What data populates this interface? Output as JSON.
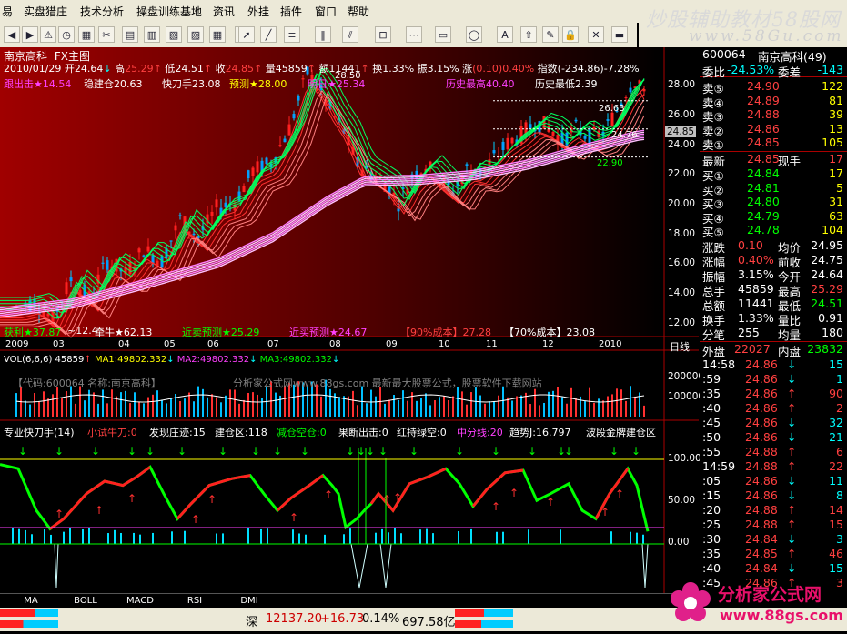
{
  "menu": [
    "易",
    "实盘猎庄",
    "技术分析",
    "操盘训练基地",
    "资讯",
    "外挂",
    "插件",
    "窗口",
    "帮助"
  ],
  "toolbar_icons": [
    "back-icon",
    "forward-icon",
    "alert-icon",
    "clock-icon",
    "grid-icon",
    "cut-icon",
    "sheet1-icon",
    "sheet2-icon",
    "sheet3-icon",
    "sheet4-icon",
    "table-icon",
    "chart-icon",
    "cursor-icon",
    "line-icon",
    "lines-icon",
    "vertical-lines-icon",
    "fan-icon",
    "channel-icon",
    "gann-icon",
    "rect-icon",
    "ellipse-icon",
    "text-icon",
    "up-arrow-icon",
    "eraser-icon",
    "lock-icon",
    "delete-icon",
    "save-icon"
  ],
  "watermark": {
    "title": "炒股辅助教材58股网",
    "url": "www.58Gu.com"
  },
  "header": {
    "stock": "南京高科",
    "chart_name": "FX主图",
    "date": "2010/01/29",
    "open_label": "开",
    "open": "24.64",
    "high_label": "高",
    "high": "25.29",
    "low_label": "低",
    "low": "24.51",
    "close_label": "收",
    "close": "24.85",
    "vol_label": "量",
    "vol": "45859",
    "amt_label": "额",
    "amt": "11441",
    "turn_label": "换",
    "turn": "1.33%",
    "amp_label": "振",
    "amp": "3.15%",
    "chg_label": "涨",
    "chg": "(0.10)0.40%",
    "idx_label": "指数",
    "idx": "(-234.86)-7.28%"
  },
  "main_line2": [
    {
      "t": "跟出击★14.54",
      "c": "#ff40ff"
    },
    {
      "t": "稳建仓20.63",
      "c": "#ffffff"
    },
    {
      "t": "快刀手23.08",
      "c": "#ffffff"
    },
    {
      "t": "预测★28.00",
      "c": "#ffff00"
    },
    {
      "t": "明日★25.34",
      "c": "#ff40ff"
    },
    {
      "t": "历史最高40.40",
      "c": "#ff40ff"
    },
    {
      "t": "历史最低2.39",
      "c": "#ffffff"
    }
  ],
  "main_bottom": [
    {
      "t": "获利★37.87",
      "c": "#00ff00"
    },
    {
      "t": "~12.4",
      "c": "#ffffff"
    },
    {
      "t": "牵牛★62.13",
      "c": "#ffffff"
    },
    {
      "t": "近卖预测★25.29",
      "c": "#00ff00"
    },
    {
      "t": "近买预测★24.67",
      "c": "#ff40ff"
    },
    {
      "t": "【90%成本】27.28",
      "c": "#ff4040"
    },
    {
      "t": "【70%成本】23.08",
      "c": "#ffffff"
    }
  ],
  "price_axis": [
    "28.00",
    "26.00",
    "24.00",
    "22.00",
    "20.00",
    "18.00",
    "16.00",
    "14.00",
    "12.00"
  ],
  "price_tag": "24.85",
  "annotations": {
    "top": "28.50",
    "a1": "26.63",
    "a2": "24.76",
    "a3": "22.90"
  },
  "time_axis": [
    "2009",
    "03",
    "04",
    "05",
    "06",
    "07",
    "08",
    "09",
    "10",
    "11",
    "12",
    "2010"
  ],
  "time_unit": "日线",
  "vol_header": {
    "t1": "VOL(6,6,6)",
    "t2": "45859",
    "t3": "MA1:49802.332",
    "t4": "MA2:49802.332",
    "t5": "MA3:49802.332"
  },
  "vol_text": "【代码:600064 名称:南京高科】",
  "vol_text2": "分析家公式网www.88gs.com 最新最大股票公式，股票软件下载网站",
  "vol_axis": [
    "200000",
    "100000"
  ],
  "ind_header": [
    {
      "t": "专业快刀手(14)",
      "c": "#ffffff"
    },
    {
      "t": "小试牛刀:0",
      "c": "#ff4040"
    },
    {
      "t": "发现庄迹:15",
      "c": "#ffffff"
    },
    {
      "t": "建仓区:118",
      "c": "#ffffff"
    },
    {
      "t": "减仓空仓:0",
      "c": "#00ff00"
    },
    {
      "t": "果断出击:0",
      "c": "#ffffff"
    },
    {
      "t": "红持绿空:0",
      "c": "#ffffff"
    },
    {
      "t": "中分线:20",
      "c": "#ff40ff"
    },
    {
      "t": "趋势J:16.797",
      "c": "#ffffff"
    },
    {
      "t": "波段金牌建仓区",
      "c": "#ffffff"
    }
  ],
  "ind_axis": [
    "100.00",
    "50.00",
    "0.00"
  ],
  "tabs": [
    "MA",
    "BOLL",
    "MACD",
    "RSI",
    "DMI"
  ],
  "quote": {
    "code": "600064",
    "name": "南京高科(49)",
    "weibi_label": "委比",
    "weibi": "-24.53%",
    "weicha_label": "委差",
    "weicha": "-143",
    "sells": [
      [
        "卖⑤",
        "24.90",
        "122"
      ],
      [
        "卖④",
        "24.89",
        "81"
      ],
      [
        "卖③",
        "24.88",
        "39"
      ],
      [
        "卖②",
        "24.86",
        "13"
      ],
      [
        "卖①",
        "24.85",
        "105"
      ]
    ],
    "last_label": "最新",
    "last": "24.85",
    "xian_label": "现手",
    "xian": "17",
    "buys": [
      [
        "买①",
        "24.84",
        "17"
      ],
      [
        "买②",
        "24.81",
        "5"
      ],
      [
        "买③",
        "24.80",
        "31"
      ],
      [
        "买④",
        "24.79",
        "63"
      ],
      [
        "买⑤",
        "24.78",
        "104"
      ]
    ],
    "stats": [
      [
        "涨跌",
        "0.10",
        "均价",
        "24.95"
      ],
      [
        "涨幅",
        "0.40%",
        "前收",
        "24.75"
      ],
      [
        "振幅",
        "3.15%",
        "今开",
        "24.64"
      ],
      [
        "总手",
        "45859",
        "最高",
        "25.29"
      ],
      [
        "总额",
        "11441",
        "最低",
        "24.51"
      ],
      [
        "换手",
        "1.33%",
        "量比",
        "0.91"
      ],
      [
        "分笔",
        "255",
        "均量",
        "180"
      ]
    ],
    "wai_label": "外盘",
    "wai": "22027",
    "nei_label": "内盘",
    "nei": "23832",
    "ticks": [
      [
        "14:58",
        "24.86",
        "↓",
        "15"
      ],
      [
        ":59",
        "24.86",
        "↓",
        "1"
      ],
      [
        ":35",
        "24.86",
        "↑",
        "90"
      ],
      [
        ":40",
        "24.86",
        "↑",
        "2"
      ],
      [
        ":45",
        "24.86",
        "↓",
        "32"
      ],
      [
        ":50",
        "24.86",
        "↓",
        "21"
      ],
      [
        ":55",
        "24.88",
        "↑",
        "6"
      ],
      [
        "14:59",
        "24.88",
        "↑",
        "22"
      ],
      [
        ":05",
        "24.86",
        "↓",
        "11"
      ],
      [
        ":15",
        "24.86",
        "↓",
        "8"
      ],
      [
        ":20",
        "24.88",
        "↑",
        "14"
      ],
      [
        ":25",
        "24.88",
        "↑",
        "15"
      ],
      [
        ":30",
        "24.84",
        "↓",
        "3"
      ],
      [
        ":35",
        "24.85",
        "↑",
        "46"
      ],
      [
        ":40",
        "24.84",
        "↓",
        "15"
      ],
      [
        ":45",
        "24.86",
        "↑",
        "3"
      ]
    ]
  },
  "status": {
    "market": "深",
    "index": "12137.20",
    "chg": "+16.73",
    "pct": "0.14%",
    "amt": "697.58亿"
  },
  "logo": {
    "title": "分析家公式网",
    "url": "www.88gs.com"
  },
  "colors": {
    "bg": "#000000",
    "up": "#ff4040",
    "down": "#00ffff",
    "panel": "#ece9d8"
  }
}
